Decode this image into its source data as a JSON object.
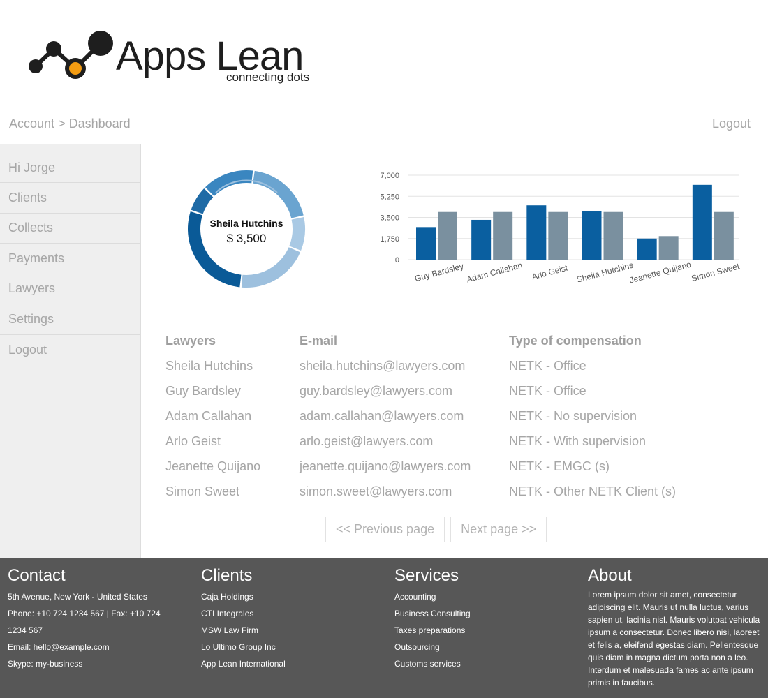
{
  "brand": {
    "title": "Apps Lean",
    "tagline": "connecting dots",
    "accent_color": "#f39c12",
    "dark_color": "#1e1e1e"
  },
  "topbar": {
    "breadcrumb": [
      "Account",
      ">",
      "Dashboard"
    ],
    "logout_label": "Logout"
  },
  "sidebar": {
    "greeting": "Hi Jorge",
    "items": [
      {
        "label": "Clients"
      },
      {
        "label": "Collects"
      },
      {
        "label": "Payments"
      },
      {
        "label": "Lawyers"
      },
      {
        "label": "Settings"
      },
      {
        "label": "Logout"
      }
    ]
  },
  "donut": {
    "name": "Sheila Hutchins",
    "value": "$ 3,500",
    "segments": [
      {
        "value": 3500,
        "color": "#0a5a97"
      },
      {
        "value": 900,
        "color": "#1e6aa6"
      },
      {
        "value": 1800,
        "color": "#3a86c0"
      },
      {
        "value": 2400,
        "color": "#6aa4d0"
      },
      {
        "value": 1200,
        "color": "#a9c9e4"
      },
      {
        "value": 2500,
        "color": "#9dc0de"
      }
    ]
  },
  "chart_data": {
    "type": "bar",
    "categories": [
      "Guy Bardsley",
      "Adam Callahan",
      "Arlo Geist",
      "Sheila Hutchins",
      "Jeanette Quijano",
      "Simon Sweet"
    ],
    "series": [
      {
        "values": [
          2700,
          3300,
          4500,
          4050,
          1750,
          6200
        ],
        "color": "#0a5fa0"
      },
      {
        "values": [
          3950,
          3950,
          3950,
          3950,
          1950,
          3950
        ],
        "color": "#7a909f"
      }
    ],
    "yticks": [
      "7,000",
      "5,250",
      "3,500",
      "1,750",
      "0"
    ],
    "ylim": [
      0,
      7000
    ],
    "grid": true
  },
  "table": {
    "headers": [
      "Lawyers",
      "E-mail",
      "Type of compensation"
    ],
    "rows": [
      [
        "Sheila Hutchins",
        "sheila.hutchins@lawyers.com",
        "NETK - Office"
      ],
      [
        "Guy Bardsley",
        "guy.bardsley@lawyers.com",
        "NETK - Office"
      ],
      [
        "Adam Callahan",
        "adam.callahan@lawyers.com",
        "NETK - No supervision"
      ],
      [
        "Arlo Geist",
        "arlo.geist@lawyers.com",
        "NETK - With supervision"
      ],
      [
        "Jeanette Quijano",
        "jeanette.quijano@lawyers.com",
        "NETK - EMGC (s)"
      ],
      [
        "Simon Sweet",
        "simon.sweet@lawyers.com",
        "NETK - Other NETK Client (s)"
      ]
    ]
  },
  "pager": {
    "prev_label": "<< Previous page",
    "next_label": "Next page >>"
  },
  "footer": {
    "contact": {
      "title": "Contact",
      "lines": [
        "5th Avenue, New York - United States",
        "Phone: +10 724 1234 567 | Fax: +10 724",
        "1234 567",
        "Email: hello@example.com",
        "Skype: my-business"
      ]
    },
    "clients": {
      "title": "Clients",
      "lines": [
        "Caja Holdings",
        "CTI Integrales",
        "MSW Law Firm",
        "Lo Ultimo Group Inc",
        "App Lean International"
      ]
    },
    "services": {
      "title": "Services",
      "lines": [
        "Accounting",
        "Business Consulting",
        "Taxes preparations",
        "Outsourcing",
        "Customs services"
      ]
    },
    "about": {
      "title": "About",
      "text": "Lorem ipsum dolor sit amet, consectetur adipiscing elit. Mauris ut nulla luctus, varius sapien ut, lacinia nisl. Mauris volutpat vehicula ipsum a consectetur. Donec libero nisi, laoreet et felis a, eleifend egestas diam. Pellentesque quis diam in magna dictum porta non a leo. Interdum et malesuada fames ac ante ipsum primis in faucibus."
    }
  }
}
